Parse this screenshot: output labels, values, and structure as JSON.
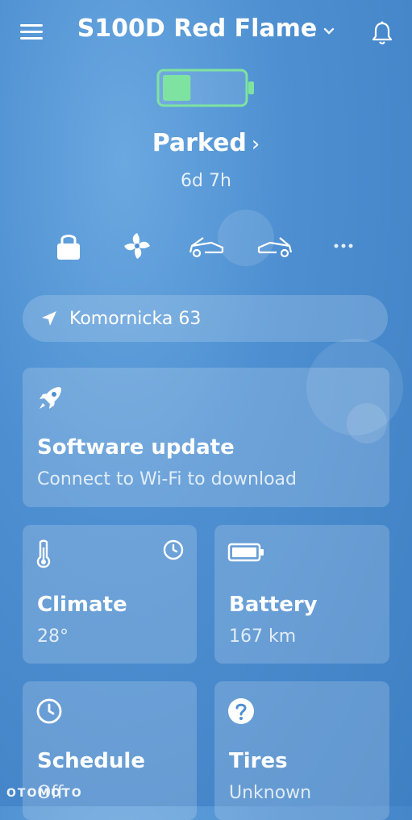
{
  "header": {
    "title": "S100D Red Flame"
  },
  "battery": {
    "level_fraction": 0.35
  },
  "status": {
    "label": "Parked",
    "duration": "6d 7h"
  },
  "location": {
    "address": "Komornicka 63"
  },
  "update_card": {
    "title": "Software update",
    "subtitle": "Connect to Wi-Fi to download"
  },
  "tiles": [
    {
      "title": "Climate",
      "value": "28°"
    },
    {
      "title": "Battery",
      "value": "167 km"
    },
    {
      "title": "Schedule",
      "value": "Off"
    },
    {
      "title": "Tires",
      "value": "Unknown"
    }
  ],
  "watermark": "OTOMOTO",
  "colors": {
    "battery_fill": "#7ee3a0",
    "battery_border": "#7ee3a0",
    "background": "#4d8fd1"
  },
  "icons": [
    "menu-icon",
    "chevron-down-icon",
    "bell-icon",
    "lock-icon",
    "fan-icon",
    "frunk-icon",
    "trunk-icon",
    "more-icon",
    "location-arrow-icon",
    "rocket-icon",
    "thermometer-icon",
    "clock-icon",
    "battery-icon",
    "question-icon"
  ]
}
